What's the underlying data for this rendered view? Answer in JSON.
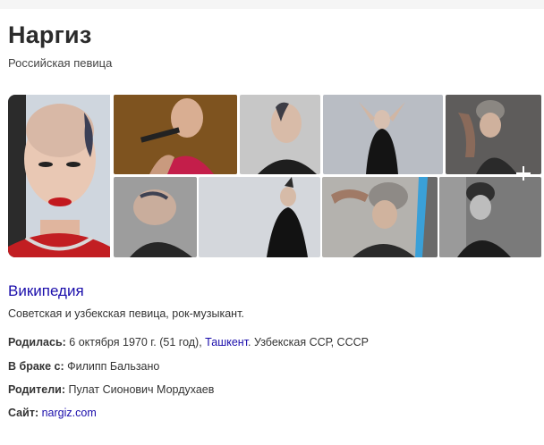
{
  "entity": {
    "name": "Наргиз",
    "subtitle": "Российская певица"
  },
  "images": [
    {
      "alt": "portrait-main"
    },
    {
      "alt": "singing-microphone"
    },
    {
      "alt": "profile-closeup"
    },
    {
      "alt": "black-dress-arms-up"
    },
    {
      "alt": "headwrap-tattoo"
    },
    {
      "alt": "side-profile"
    },
    {
      "alt": "black-dress-standing"
    },
    {
      "alt": "headwrap-arm-raised"
    },
    {
      "alt": "headwrap-bw"
    }
  ],
  "wikipedia": {
    "label": "Википедия",
    "description": "Советская и узбекская певица, рок-музыкант."
  },
  "facts": {
    "born": {
      "label": "Родилась:",
      "value_prefix": "6 октября 1970 г. (51 год),",
      "place_link": "Ташкент",
      "value_suffix": ". Узбекская ССР, СССР"
    },
    "spouse": {
      "label": "В браке с:",
      "value": "Филипп Бальзано"
    },
    "parents": {
      "label": "Родители:",
      "value": "Пулат Сионович Мордухаев"
    },
    "site": {
      "label": "Сайт:",
      "value": "nargiz.com"
    }
  }
}
